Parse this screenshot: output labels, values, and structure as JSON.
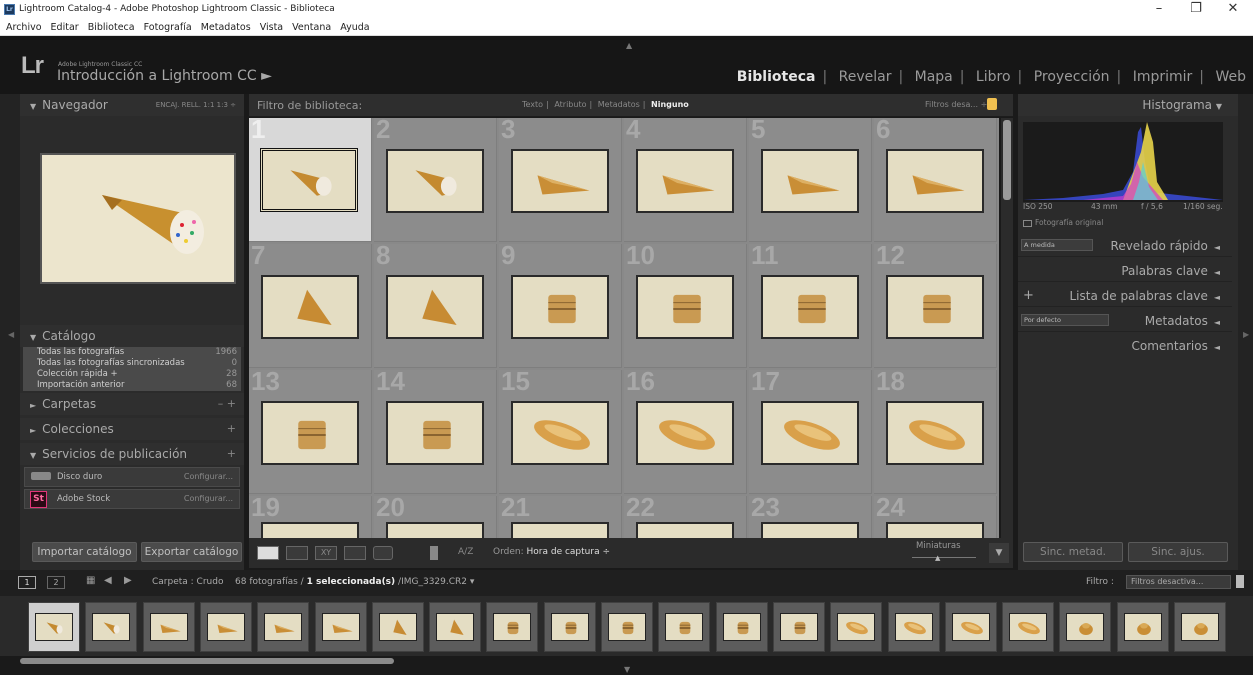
{
  "window": {
    "title": "Lightroom Catalog-4 - Adobe Photoshop Lightroom Classic - Biblioteca",
    "controls": [
      "–",
      "❐",
      "✕"
    ]
  },
  "menu": [
    "Archivo",
    "Editar",
    "Biblioteca",
    "Fotografía",
    "Metadatos",
    "Vista",
    "Ventana",
    "Ayuda"
  ],
  "identity": {
    "logo": "Lr",
    "product": "Adobe Lightroom Classic CC",
    "plate": "Introducción a Lightroom CC ►"
  },
  "modules": [
    "Biblioteca",
    "Revelar",
    "Mapa",
    "Libro",
    "Proyección",
    "Imprimir",
    "Web"
  ],
  "active_module": "Biblioteca",
  "navigator": {
    "title": "Navegador",
    "zoom_options": "ENCAJ.   RELL.   1:1   1:3 ÷"
  },
  "catalog": {
    "title": "Catálogo",
    "items": [
      {
        "label": "Todas las fotografías",
        "count": "1966"
      },
      {
        "label": "Todas las fotografías sincronizadas",
        "count": "0"
      },
      {
        "label": "Colección rápida +",
        "count": "28"
      },
      {
        "label": "Importación anterior",
        "count": "68"
      }
    ]
  },
  "folders": {
    "title": "Carpetas",
    "actions": "– +"
  },
  "collections": {
    "title": "Colecciones",
    "actions": "+"
  },
  "publish": {
    "title": "Servicios de publicación",
    "actions": "+",
    "services": [
      {
        "label": "Disco duro",
        "action": "Configurar..."
      },
      {
        "label": "Adobe Stock",
        "action": "Configurar...",
        "icon_text": "St"
      }
    ]
  },
  "left_buttons": {
    "import": "Importar catálogo",
    "export": "Exportar catálogo"
  },
  "filter": {
    "label": "Filtro de biblioteca:",
    "tabs": [
      "Texto",
      "Atributo",
      "Metadatos",
      "Ninguno"
    ],
    "selected_tab": "Ninguno",
    "presets": "Filtros desa... ÷"
  },
  "grid": {
    "cells": [
      {
        "n": "1",
        "shape": "cone",
        "selected": true
      },
      {
        "n": "2",
        "shape": "cone"
      },
      {
        "n": "3",
        "shape": "triangle"
      },
      {
        "n": "4",
        "shape": "triangle"
      },
      {
        "n": "5",
        "shape": "triangle"
      },
      {
        "n": "6",
        "shape": "triangle"
      },
      {
        "n": "7",
        "shape": "wedge"
      },
      {
        "n": "8",
        "shape": "wedge"
      },
      {
        "n": "9",
        "shape": "stack"
      },
      {
        "n": "10",
        "shape": "stack"
      },
      {
        "n": "11",
        "shape": "stack"
      },
      {
        "n": "12",
        "shape": "stack"
      },
      {
        "n": "13",
        "shape": "stack"
      },
      {
        "n": "14",
        "shape": "stack"
      },
      {
        "n": "15",
        "shape": "roll"
      },
      {
        "n": "16",
        "shape": "roll"
      },
      {
        "n": "17",
        "shape": "roll"
      },
      {
        "n": "18",
        "shape": "roll"
      },
      {
        "n": "19",
        "shape": "none"
      },
      {
        "n": "20",
        "shape": "none"
      },
      {
        "n": "21",
        "shape": "none"
      },
      {
        "n": "22",
        "shape": "none"
      },
      {
        "n": "23",
        "shape": "none"
      },
      {
        "n": "24",
        "shape": "none"
      }
    ]
  },
  "toolbar": {
    "sort_label": "Orden:",
    "sort_value": "Hora de captura ÷",
    "sort_icon": "A/Z",
    "thumbs_label": "Miniaturas"
  },
  "histogram": {
    "title": "Histograma",
    "iso": "ISO 250",
    "focal": "43 mm",
    "aperture": "f / 5,6",
    "shutter": "1/160 seg.",
    "original": "Fotografía original"
  },
  "right_panels": [
    {
      "label": "Revelado rápido",
      "prefix": "A medida"
    },
    {
      "label": "Palabras clave",
      "prefix": ""
    },
    {
      "label": "Lista de palabras clave",
      "prefix": "+"
    },
    {
      "label": "Metadatos",
      "prefix": "Por defecto"
    },
    {
      "label": "Comentarios",
      "prefix": ""
    }
  ],
  "right_buttons": {
    "sync_meta": "Sinc. metad.",
    "sync_settings": "Sinc. ajus."
  },
  "filmstrip": {
    "view1": "1",
    "view2": "2",
    "folder": "Carpeta : Crudo",
    "status_count": "68 fotografías /",
    "status_selected": "1 seleccionada(s)",
    "status_file": "/IMG_3329.CR2 ▾",
    "filter_label": "Filtro :",
    "filter_value": "Filtros desactiva...",
    "thumbs": [
      "cone",
      "cone",
      "triangle",
      "triangle",
      "triangle",
      "triangle",
      "wedge",
      "wedge",
      "stack",
      "stack",
      "stack",
      "stack",
      "stack",
      "stack",
      "roll",
      "roll",
      "roll",
      "roll",
      "bun",
      "bun",
      "bun"
    ]
  }
}
